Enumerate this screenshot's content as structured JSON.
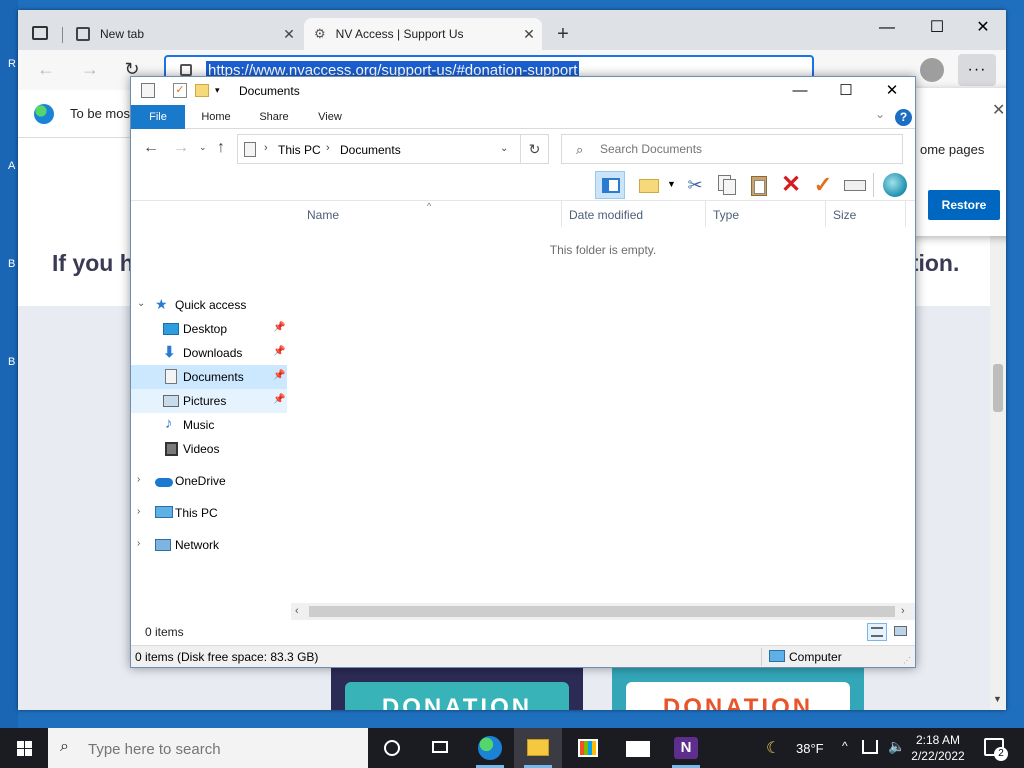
{
  "desktop": {
    "strip_letters": [
      "R",
      "A",
      "B",
      "B"
    ]
  },
  "browser": {
    "tabs": [
      {
        "title": "New tab",
        "close": "✕"
      },
      {
        "title": "NV Access | Support Us",
        "close": "✕"
      }
    ],
    "new_tab": "+",
    "window_controls": {
      "minimize": "—",
      "maximize": "☐",
      "close": "✕"
    },
    "nav": {
      "back": "←",
      "forward": "→",
      "refresh": "↻"
    },
    "address_url": "https://www.nvaccess.org/support-us/#donation-support",
    "more": "···",
    "notification_text": "To be mos",
    "page": {
      "heading_left": "If you ha",
      "heading_right": "ation.",
      "donation_label": "DONATION"
    },
    "restore_popup": {
      "text": "ome pages",
      "button": "Restore",
      "close": "✕"
    }
  },
  "explorer": {
    "title": "Documents",
    "window_controls": {
      "minimize": "—",
      "maximize": "☐",
      "close": "✕"
    },
    "ribbon_tabs": {
      "file": "File",
      "home": "Home",
      "share": "Share",
      "view": "View"
    },
    "ribbon_expand": "⌄",
    "help": "?",
    "breadcrumb": {
      "this_pc": "This PC",
      "documents": "Documents",
      "sep": "›",
      "dropdown": "⌄"
    },
    "refresh": "↻",
    "search_placeholder": "Search Documents",
    "nav_pane": {
      "quick_access": "Quick access",
      "desktop": "Desktop",
      "downloads": "Downloads",
      "documents": "Documents",
      "pictures": "Pictures",
      "music": "Music",
      "videos": "Videos",
      "onedrive": "OneDrive",
      "this_pc": "This PC",
      "network": "Network"
    },
    "columns": {
      "name": "Name",
      "date_modified": "Date modified",
      "type": "Type",
      "size": "Size"
    },
    "empty_message": "This folder is empty.",
    "status_count": "0 items",
    "details_text": "0 items (Disk free space: 83.3 GB)",
    "details_location": "Computer"
  },
  "taskbar": {
    "search_placeholder": "Type here to search",
    "weather_temp": "38°F",
    "time": "2:18 AM",
    "date": "2/22/2022",
    "notification_count": "2"
  },
  "colors": {
    "desktop": "#1f6fbf",
    "ribbon_file": "#1979ca",
    "selection": "#cce8ff",
    "restore_button": "#0067c0",
    "delete_icon": "#d71920"
  }
}
